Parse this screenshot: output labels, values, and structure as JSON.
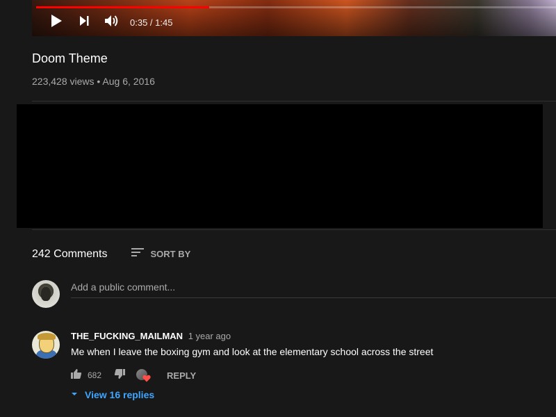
{
  "player": {
    "current_time": "0:35",
    "duration": "1:45",
    "time_display": "0:35 / 1:45",
    "progress_fraction": 0.333,
    "icons": [
      "play-icon",
      "next-icon",
      "volume-icon"
    ]
  },
  "video": {
    "title": "Doom Theme",
    "meta": "223,428 views • Aug 6, 2016"
  },
  "comments": {
    "count_label": "242 Comments",
    "sort_label": "SORT BY",
    "add_placeholder": "Add a public comment...",
    "items": [
      {
        "author": "THE_FUCKING_MAILMAN",
        "time": "1 year ago",
        "text": "Me when I leave the boxing gym and look at the elementary school across the street",
        "likes": "682",
        "reply_label": "REPLY",
        "view_replies_label": "View 16 replies"
      }
    ]
  },
  "colors": {
    "background": "#181818",
    "progress": "#ff0000",
    "link": "#3ea6ff",
    "heart": "#ff4e45"
  }
}
